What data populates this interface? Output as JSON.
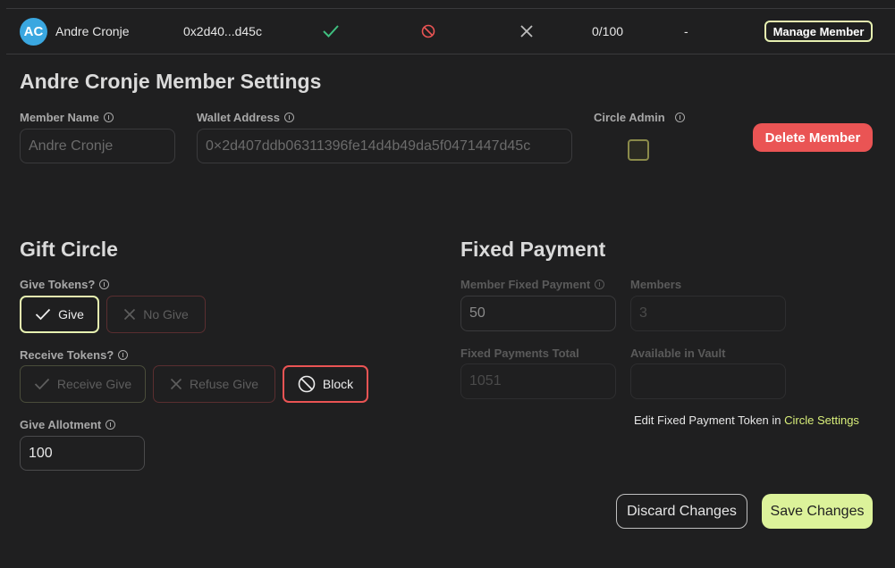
{
  "member_row": {
    "avatar_initials": "AC",
    "name": "Andre Cronje",
    "address_short": "0x2d40...d45c",
    "allotment": "0/100",
    "dash": "-",
    "manage_label": "Manage Member",
    "icons": [
      "check-icon",
      "block-icon",
      "x-icon"
    ]
  },
  "settings": {
    "title": "Andre Cronje Member Settings",
    "member_name_label": "Member Name",
    "member_name_placeholder": "Andre Cronje",
    "wallet_label": "Wallet Address",
    "wallet_placeholder": "0×2d407ddb06311396fe14d4b49da5f0471447d45c",
    "circle_admin_label": "Circle Admin",
    "delete_label": "Delete Member"
  },
  "gift_circle": {
    "title": "Gift Circle",
    "give_tokens_label": "Give Tokens?",
    "give_label": "Give",
    "no_give_label": "No Give",
    "receive_tokens_label": "Receive Tokens?",
    "receive_give_label": "Receive Give",
    "refuse_give_label": "Refuse Give",
    "block_label": "Block",
    "allotment_label": "Give Allotment",
    "allotment_value": "100"
  },
  "fixed_payment": {
    "title": "Fixed Payment",
    "member_fixed_label": "Member Fixed Payment",
    "member_fixed_value": "50",
    "members_label": "Members",
    "members_value": "3",
    "total_label": "Fixed Payments Total",
    "total_value": "1051",
    "vault_label": "Available in Vault",
    "vault_value": "",
    "note_prefix": "Edit Fixed Payment Token in ",
    "note_link": "Circle Settings"
  },
  "actions": {
    "discard_label": "Discard Changes",
    "save_label": "Save Changes"
  },
  "colors": {
    "background": "#1f1f20",
    "accent": "#dcf29a",
    "danger": "#ea5454",
    "avatar": "#3aa7e0",
    "success": "#3fbf7f"
  }
}
